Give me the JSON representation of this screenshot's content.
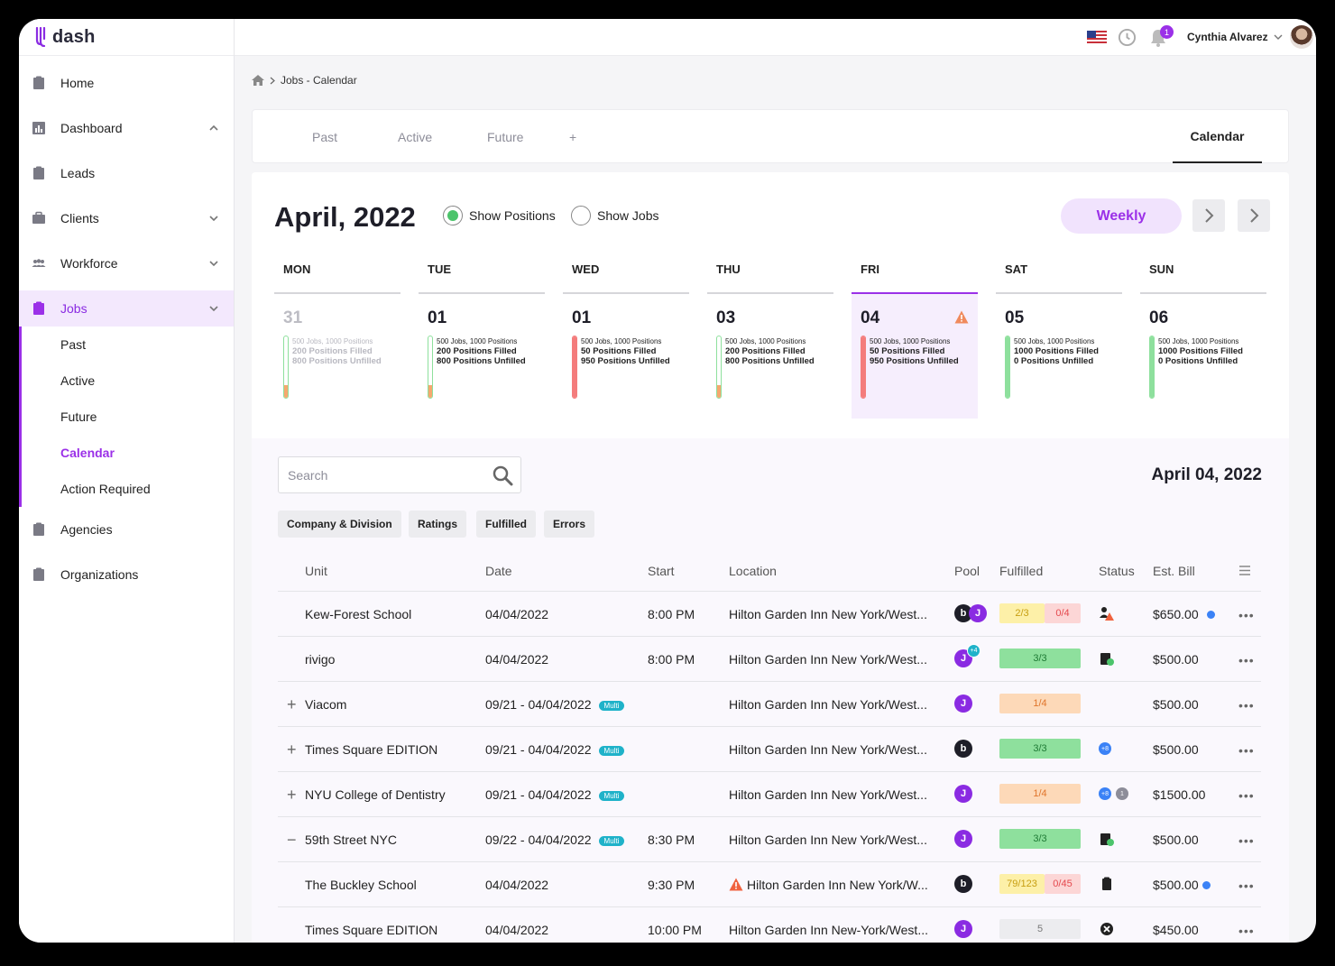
{
  "app": {
    "name": "dash"
  },
  "sidebar": {
    "items": [
      {
        "label": "Home"
      },
      {
        "label": "Dashboard"
      },
      {
        "label": "Leads"
      },
      {
        "label": "Clients"
      },
      {
        "label": "Workforce"
      },
      {
        "label": "Jobs"
      },
      {
        "label": "Agencies"
      },
      {
        "label": "Organizations"
      }
    ],
    "jobs_sub": [
      {
        "label": "Past"
      },
      {
        "label": "Active"
      },
      {
        "label": "Future"
      },
      {
        "label": "Calendar"
      },
      {
        "label": "Action Required"
      }
    ]
  },
  "topbar": {
    "notification_count": "1",
    "user_name": "Cynthia Alvarez"
  },
  "breadcrumb": {
    "label": "Jobs - Calendar"
  },
  "tabs": {
    "past": "Past",
    "active": "Active",
    "future": "Future",
    "add": "+",
    "calendar": "Calendar"
  },
  "calendar": {
    "title": "April, 2022",
    "show_positions": "Show Positions",
    "show_jobs": "Show Jobs",
    "view_mode": "Weekly",
    "days": [
      {
        "name": "MON",
        "num": "31",
        "summary": "500 Jobs, 1000 Positions",
        "filled": "200 Positions Filled",
        "unfilled": "800 Positions Unfilled",
        "fill_pct": 20,
        "fill_color": "#f6a86f"
      },
      {
        "name": "TUE",
        "num": "01",
        "summary": "500 Jobs, 1000 Positions",
        "filled": "200 Positions Filled",
        "unfilled": "800 Positions Unfilled",
        "fill_pct": 20,
        "fill_color": "#f6a86f"
      },
      {
        "name": "WED",
        "num": "01",
        "summary": "500 Jobs, 1000 Positions",
        "filled": "50 Positions Filled",
        "unfilled": "950 Positions Unfilled",
        "fill_pct": 100,
        "fill_color": "#f47c7c"
      },
      {
        "name": "THU",
        "num": "03",
        "summary": "500 Jobs, 1000 Positions",
        "filled": "200 Positions Filled",
        "unfilled": "800 Positions Unfilled",
        "fill_pct": 20,
        "fill_color": "#f6a86f"
      },
      {
        "name": "FRI",
        "num": "04",
        "summary": "500 Jobs, 1000 Positions",
        "filled": "50 Positions Filled",
        "unfilled": "950 Positions Unfilled",
        "fill_pct": 100,
        "fill_color": "#f47c7c"
      },
      {
        "name": "SAT",
        "num": "05",
        "summary": "500 Jobs, 1000 Positions",
        "filled": "1000 Positions Filled",
        "unfilled": "0 Positions Unfilled",
        "fill_pct": 100,
        "fill_color": "#8ee09d"
      },
      {
        "name": "SUN",
        "num": "06",
        "summary": "500 Jobs, 1000 Positions",
        "filled": "1000 Positions Filled",
        "unfilled": "0 Positions Unfilled",
        "fill_pct": 100,
        "fill_color": "#8ee09d"
      }
    ]
  },
  "search": {
    "placeholder": "Search"
  },
  "selected_date": "April 04, 2022",
  "filters": [
    "Company & Division",
    "Ratings",
    "Fulfilled",
    "Errors"
  ],
  "table": {
    "headers": {
      "unit": "Unit",
      "date": "Date",
      "start": "Start",
      "location": "Location",
      "pool": "Pool",
      "fulfilled": "Fulfilled",
      "status": "Status",
      "bill": "Est. Bill"
    },
    "multi_label": "Multi",
    "rows": [
      {
        "unit": "Kew-Forest School",
        "date": "04/04/2022",
        "start": "8:00 PM",
        "location": "Hilton Garden Inn New York/West...",
        "bill": "$650.00",
        "fulfilled_a": "2/3",
        "fulfilled_b": "0/4"
      },
      {
        "unit": "rivigo",
        "date": "04/04/2022",
        "start": "8:00 PM",
        "location": "Hilton Garden Inn New York/West...",
        "bill": "$500.00",
        "fulfilled_a": "3/3",
        "pool_extra": "+4"
      },
      {
        "unit": "Viacom",
        "date": "09/21 - 04/04/2022",
        "start": "",
        "location": "Hilton Garden Inn New York/West...",
        "bill": "$500.00",
        "fulfilled_a": "1/4",
        "expander": "+"
      },
      {
        "unit": "Times Square EDITION",
        "date": "09/21 - 04/04/2022",
        "start": "",
        "location": "Hilton Garden Inn New York/West...",
        "bill": "$500.00",
        "fulfilled_a": "3/3",
        "expander": "+",
        "status_badge": "+8"
      },
      {
        "unit": "NYU College of Dentistry",
        "date": "09/21 - 04/04/2022",
        "start": "",
        "location": "Hilton Garden Inn New York/West...",
        "bill": "$1500.00",
        "fulfilled_a": "1/4",
        "expander": "+",
        "status_badge": "+8",
        "status_count": "1"
      },
      {
        "unit": "59th Street NYC",
        "date": "09/22 - 04/04/2022",
        "start": "8:30 PM",
        "location": "Hilton Garden Inn New York/West...",
        "bill": "$500.00",
        "fulfilled_a": "3/3",
        "expander": "−"
      },
      {
        "unit": "The Buckley School",
        "date": "04/04/2022",
        "start": "9:30 PM",
        "location": "Hilton Garden Inn New York/W...",
        "bill": "$500.00",
        "fulfilled_a": "79/123",
        "fulfilled_b": "0/45"
      },
      {
        "unit": "Times Square EDITION",
        "date": "04/04/2022",
        "start": "10:00 PM",
        "location": "Hilton Garden Inn New-York/West...",
        "bill": "$450.00",
        "fulfilled_a": "5"
      }
    ]
  }
}
